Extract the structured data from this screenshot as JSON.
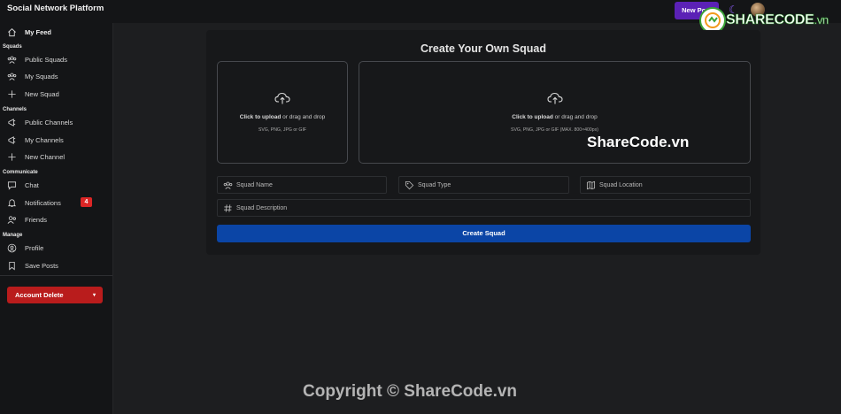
{
  "header": {
    "app_title": "Social Network Platform",
    "new_post_label": "New Post",
    "theme_icon": "moon-icon",
    "avatar_icon": "user-avatar"
  },
  "logo": {
    "main": "SHARECODE",
    "suffix": ".vn"
  },
  "sidebar": {
    "my_feed": "My Feed",
    "squads_title": "Squads",
    "public_squads": "Public Squads",
    "my_squads": "My Squads",
    "new_squad": "New Squad",
    "channels_title": "Channels",
    "public_channels": "Public Channels",
    "my_channels": "My Channels",
    "new_channel": "New Channel",
    "communicate_title": "Communicate",
    "chat": "Chat",
    "notifications": "Notifications",
    "notifications_count": "4",
    "friends": "Friends",
    "manage_title": "Manage",
    "profile": "Profile",
    "save_posts": "Save Posts",
    "account_delete": "Account Delete"
  },
  "form": {
    "title": "Create Your Own Squad",
    "upload_small": {
      "click_text": "Click to upload",
      "rest_text": " or drag and drop",
      "hint": "SVG, PNG, JPG or GIF"
    },
    "upload_large": {
      "click_text": "Click to upload",
      "rest_text": " or drag and drop",
      "hint": "SVG, PNG, JPG or GIF (MAX. 800×400px)"
    },
    "squad_name_placeholder": "Squad Name",
    "squad_type_placeholder": "Squad Type",
    "squad_location_placeholder": "Squad Location",
    "squad_description_placeholder": "Squad Description",
    "submit_label": "Create Squad"
  },
  "watermark": {
    "center": "ShareCode.vn",
    "copyright": "Copyright © ShareCode.vn"
  },
  "colors": {
    "accent": "#5b21b6",
    "primary_button": "#0b45a6",
    "danger": "#b91c1c",
    "badge": "#dc2626",
    "background": "#1d1e20",
    "sidebar": "#141517"
  }
}
